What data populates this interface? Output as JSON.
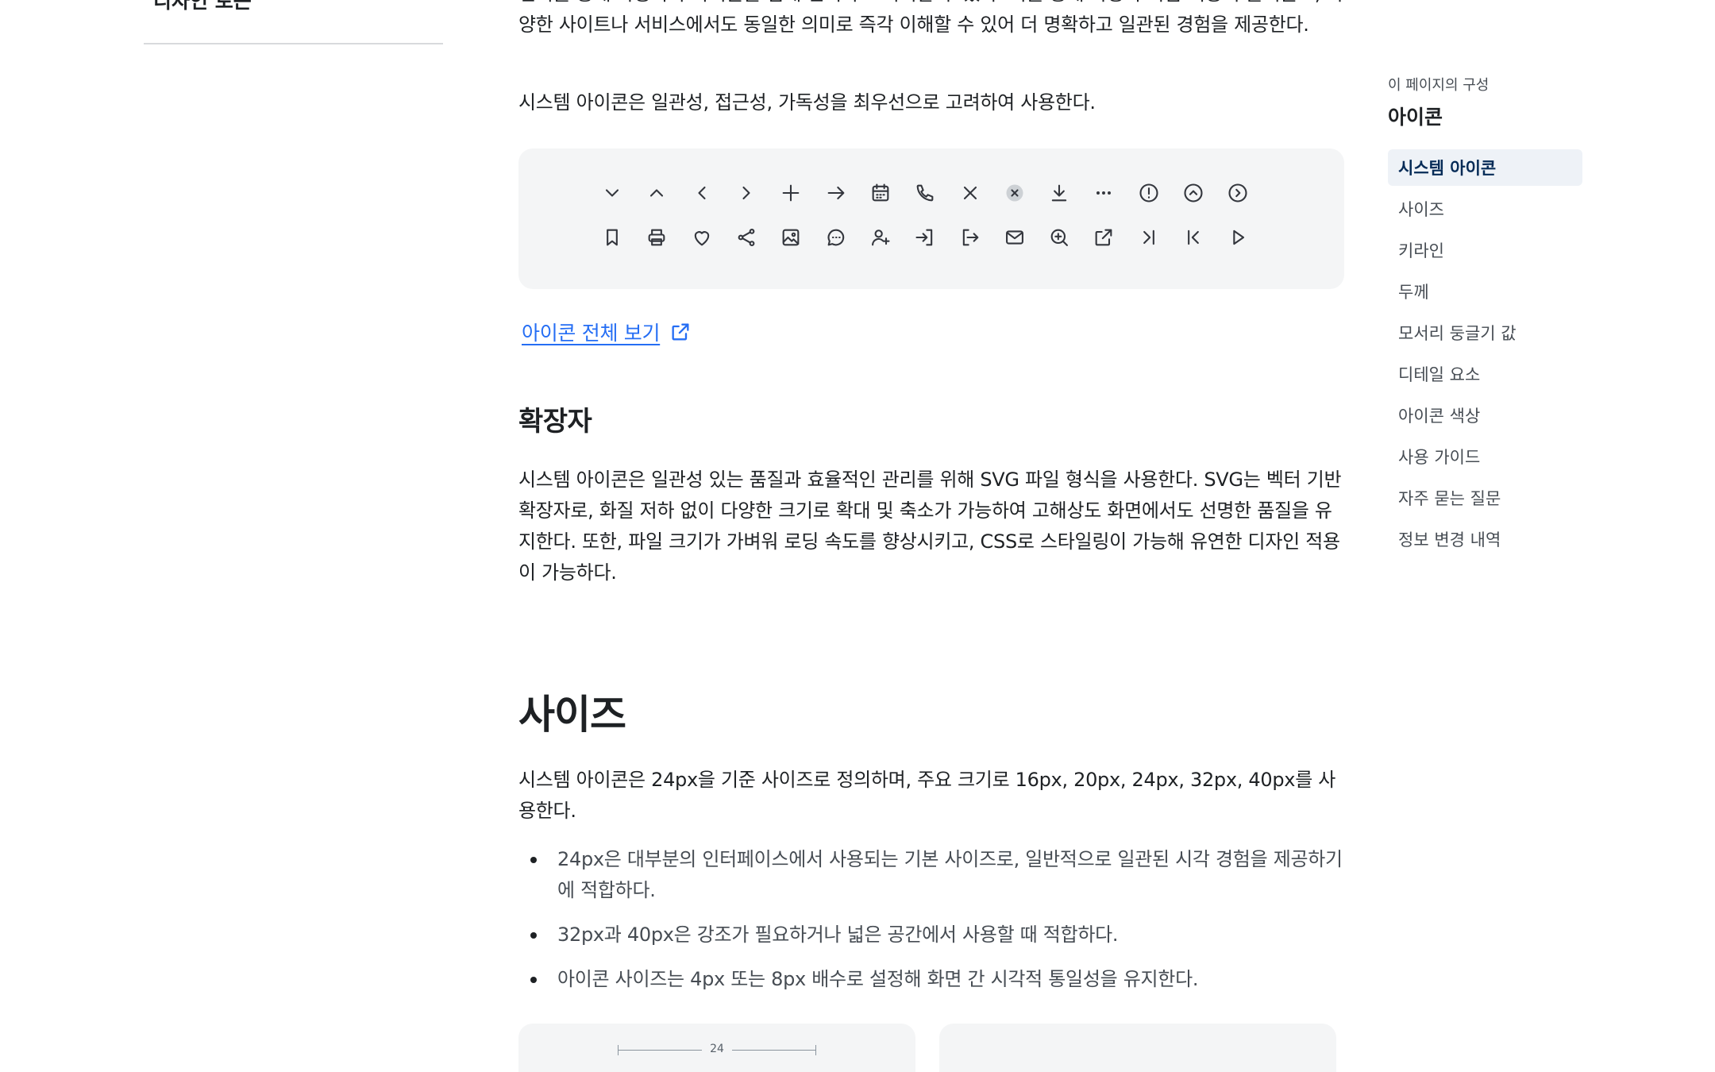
{
  "left_nav": {
    "group_title": "디자인 토큰"
  },
  "main": {
    "intro_text": "언어를 통해 사용자가 아이콘을 쉽게 인식하고 기억할 수 있다. 이를 통해 사용자 학습 비용이 줄어들고, 다양한 사이트나 서비스에서도 동일한 의미로 즉각 이해할 수 있어 더 명확하고 일관된 경험을 제공한다.",
    "priority_text": "시스템 아이콘은 일관성, 접근성, 가독성을 최우선으로 고려하여 사용한다.",
    "icon_rows": [
      [
        "chevron-down-icon",
        "chevron-up-icon",
        "chevron-left-icon",
        "chevron-right-icon",
        "plus-icon",
        "arrow-right-icon",
        "calendar-icon",
        "phone-icon",
        "close-icon",
        "close-circle-filled-icon",
        "download-icon",
        "more-horizontal-icon",
        "alert-circle-icon",
        "chevron-up-circle-icon",
        "chevron-right-circle-icon"
      ],
      [
        "bookmark-icon",
        "print-icon",
        "heart-icon",
        "share-icon",
        "image-icon",
        "chat-icon",
        "user-add-icon",
        "login-icon",
        "logout-icon",
        "mail-icon",
        "zoom-in-icon",
        "external-link-icon",
        "skip-forward-icon",
        "skip-back-icon",
        "play-icon"
      ]
    ],
    "view_all_link": "아이콘 전체 보기",
    "extension_heading": "확장자",
    "extension_text": "시스템 아이콘은 일관성 있는 품질과 효율적인 관리를 위해 SVG 파일 형식을 사용한다. SVG는 벡터 기반 확장자로, 화질 저하 없이 다양한 크기로 확대 및 축소가 가능하여 고해상도 화면에서도 선명한 품질을 유지한다. 또한, 파일 크기가 가벼워 로딩 속도를 향상시키고, CSS로 스타일링이 가능해 유연한 디자인 적용이 가능하다.",
    "size_heading": "사이즈",
    "size_text": "시스템 아이콘은 24px을 기준 사이즈로 정의하며, 주요 크기로 16px, 20px, 24px, 32px, 40px를 사용한다.",
    "bullets": [
      "24px은 대부분의 인터페이스에서 사용되는 기본 사이즈로, 일반적으로 일관된 시각 경험을 제공하기에 적합하다.",
      "32px과 40px은 강조가 필요하거나 넓은 공간에서 사용할 때 적합하다.",
      "아이콘 사이즈는 4px 또는 8px 배수로 설정해 화면 간 시각적 통일성을 유지한다."
    ],
    "card_dimension_label": "24"
  },
  "toc": {
    "label": "이 페이지의 구성",
    "title": "아이콘",
    "items": [
      "시스템 아이콘",
      "사이즈",
      "키라인",
      "두께",
      "모서리 둥글기 값",
      "디테일 요소",
      "아이콘 색상",
      "사용 가이드",
      "자주 묻는 질문",
      "정보 변경 내역"
    ],
    "active_index": 0
  },
  "colors": {
    "link": "#256ef4",
    "text": "#1e2124",
    "panel_bg": "#f4f5f6",
    "toc_active_bg": "#eef2f7"
  }
}
